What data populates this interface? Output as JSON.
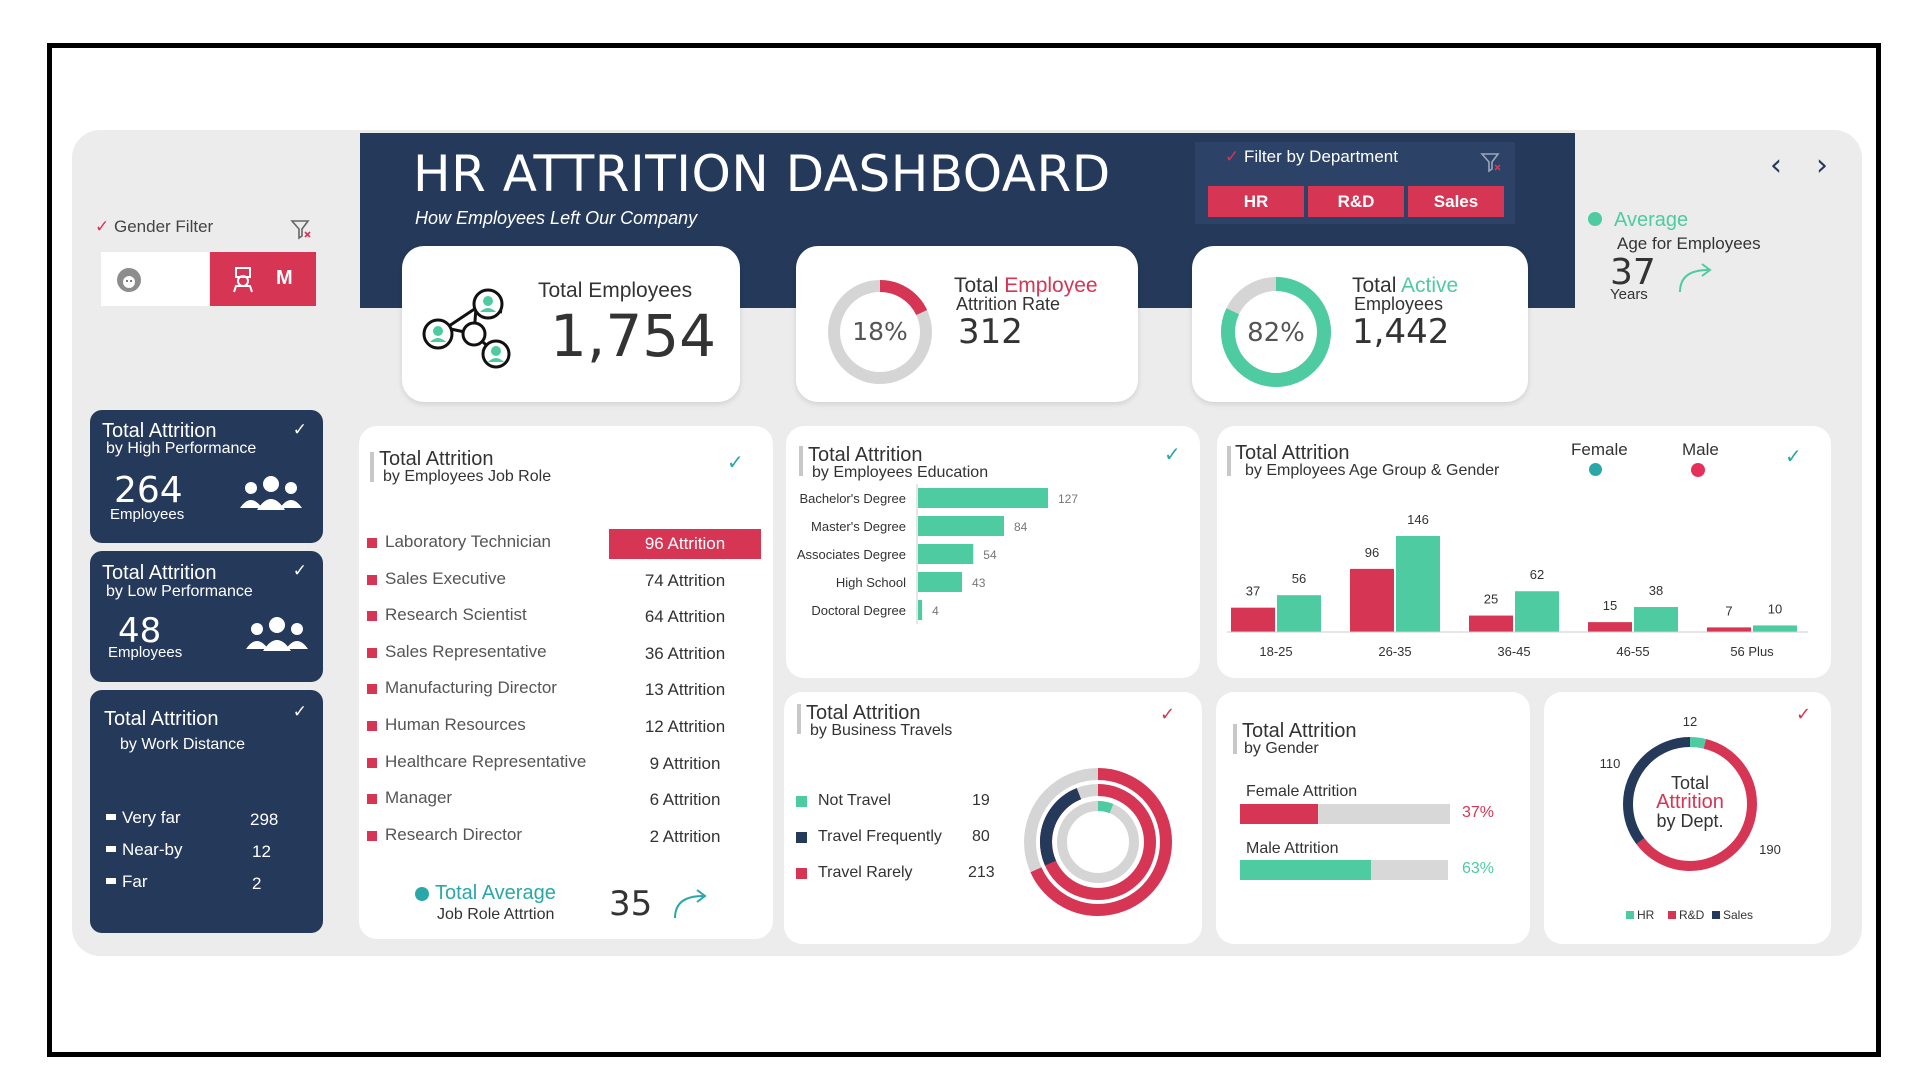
{
  "header": {
    "title": "HR ATTRITION DASHBOARD",
    "subtitle": "How Employees Left Our Company"
  },
  "department_filter": {
    "label": "Filter by Department",
    "buttons": [
      "HR",
      "R&D",
      "Sales"
    ]
  },
  "gender_filter": {
    "label": "Gender Filter",
    "male_label": "M"
  },
  "kpis": {
    "total_employees": {
      "label": "Total Employees",
      "value": "1,754"
    },
    "attrition": {
      "label_a": "Total ",
      "label_b": "Employee",
      "label_c": "Attrition Rate",
      "value": "312",
      "percent_label": "18%",
      "percent": 18
    },
    "active": {
      "label_a": "Total ",
      "label_b": "Active",
      "label_c": "Employees",
      "value": "1,442",
      "percent_label": "82%",
      "percent": 82
    }
  },
  "average_age": {
    "label": "Average",
    "sub": "Age for Employees",
    "value": "37",
    "unit": "Years"
  },
  "high_performance": {
    "title": "Total Attrition",
    "sub": "by High Performance",
    "value": "264",
    "unit": "Employees"
  },
  "low_performance": {
    "title": "Total Attrition",
    "sub": "by Low Performance",
    "value": "48",
    "unit": "Employees"
  },
  "work_distance": {
    "title": "Total Attrition",
    "sub": "by Work Distance",
    "items": [
      {
        "label": "Very far",
        "value": "298"
      },
      {
        "label": "Near-by",
        "value": "12"
      },
      {
        "label": "Far",
        "value": "2"
      }
    ]
  },
  "job_role": {
    "title": "Total Attrition",
    "sub": "by Employees Job Role",
    "rows": [
      {
        "role": "Laboratory Technician",
        "value": "96 Attrition"
      },
      {
        "role": "Sales Executive",
        "value": "74 Attrition"
      },
      {
        "role": "Research Scientist",
        "value": "64 Attrition"
      },
      {
        "role": "Sales Representative",
        "value": "36 Attrition"
      },
      {
        "role": "Manufacturing Director",
        "value": "13 Attrition"
      },
      {
        "role": "Human Resources",
        "value": "12 Attrition"
      },
      {
        "role": "Healthcare Representative",
        "value": "9 Attrition"
      },
      {
        "role": "Manager",
        "value": "6 Attrition"
      },
      {
        "role": "Research Director",
        "value": "2 Attrition"
      }
    ],
    "avg_label": "Total Average",
    "avg_sub": "Job Role Attrtion",
    "avg_value": "35"
  },
  "education": {
    "title": "Total Attrition",
    "sub": "by Employees Education"
  },
  "age_gender": {
    "title": "Total Attrition",
    "sub": "by Employees Age Group & Gender",
    "legend_female": "Female",
    "legend_male": "Male"
  },
  "business_travel": {
    "title": "Total Attrition",
    "sub": "by Business Travels",
    "items": [
      {
        "label": "Not Travel",
        "value": "19",
        "color": "#4ecba0"
      },
      {
        "label": "Travel Frequently",
        "value": "80",
        "color": "#25395a"
      },
      {
        "label": "Travel Rarely",
        "value": "213",
        "color": "#d63554"
      }
    ]
  },
  "gender": {
    "title": "Total Attrition",
    "sub": "by Gender",
    "female_label": "Female Attrition",
    "female_pct": "37%",
    "male_label": "Male Attrition",
    "male_pct": "63%"
  },
  "department": {
    "center_a": "Total",
    "center_b": "Attrition",
    "center_c": "by Dept."
  },
  "colors": {
    "navy": "#25395a",
    "red": "#d63554",
    "green": "#4ecba0",
    "teal": "#2aa7a8"
  },
  "chart_data": [
    {
      "type": "bar",
      "orientation": "horizontal",
      "categories": [
        "Bachelor's Degree",
        "Master's Degree",
        "Associates Degree",
        "High School",
        "Doctoral Degree"
      ],
      "values": [
        127,
        84,
        54,
        43,
        4
      ]
    },
    {
      "type": "bar",
      "categories": [
        "18-25",
        "26-35",
        "36-45",
        "46-55",
        "56 Plus"
      ],
      "series": [
        {
          "name": "Male",
          "values": [
            37,
            96,
            25,
            15,
            7
          ]
        },
        {
          "name": "Female",
          "values": [
            56,
            146,
            62,
            38,
            10
          ]
        }
      ]
    },
    {
      "type": "pie",
      "categories": [
        "Travel Rarely",
        "Travel Frequently",
        "Not Travel"
      ],
      "values": [
        213,
        80,
        19
      ]
    },
    {
      "type": "pie",
      "categories": [
        "HR",
        "R&D",
        "Sales"
      ],
      "values": [
        12,
        190,
        110
      ],
      "legend": [
        "HR",
        "R&D",
        "Sales"
      ]
    }
  ]
}
